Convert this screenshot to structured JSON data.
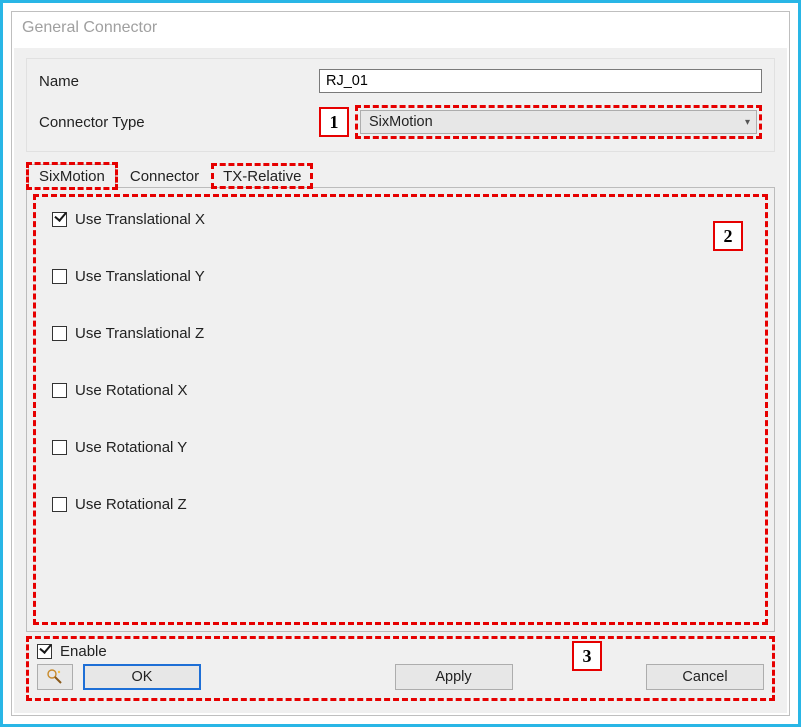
{
  "window": {
    "title": "General Connector"
  },
  "form": {
    "name_label": "Name",
    "name_value": "RJ_01",
    "type_label": "Connector Type",
    "type_value": "SixMotion"
  },
  "callouts": {
    "one": "1",
    "two": "2",
    "three": "3"
  },
  "tabs": {
    "sixmotion": "SixMotion",
    "connector": "Connector",
    "txrelative": "TX-Relative"
  },
  "options": {
    "tx": "Use Translational X",
    "ty": "Use Translational Y",
    "tz": "Use Translational Z",
    "rx": "Use Rotational X",
    "ry": "Use Rotational Y",
    "rz": "Use Rotational Z"
  },
  "bottom": {
    "enable": "Enable",
    "ok": "OK",
    "apply": "Apply",
    "cancel": "Cancel"
  },
  "colors": {
    "accent": "#29b6e6",
    "annotation": "#e60000"
  }
}
